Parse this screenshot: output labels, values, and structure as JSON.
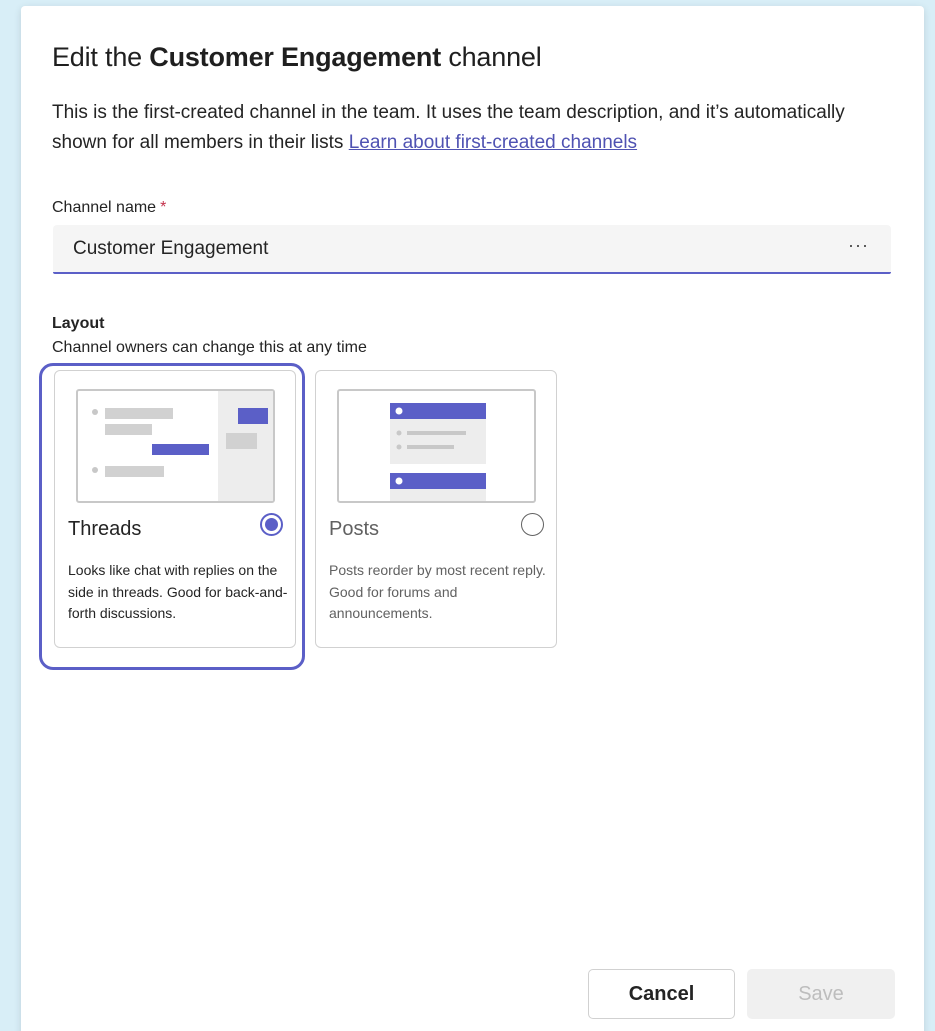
{
  "dialog": {
    "title_prefix": "Edit the ",
    "title_bold": "Customer Engagement",
    "title_suffix": " channel",
    "description": "This is the first-created channel in the team. It uses the team description, and it’s automatically shown for all members in their lists ",
    "learn_link": "Learn about first-created channels"
  },
  "channel_name": {
    "label": "Channel name",
    "required_mark": "*",
    "value": "Customer Engagement",
    "more_icon": "ellipsis-icon",
    "more_text": "···"
  },
  "layout": {
    "title": "Layout",
    "subtitle": "Channel owners can change this at any time",
    "selected": "Threads",
    "options": [
      {
        "title": "Threads",
        "description": "Looks like chat with replies on the side in threads. Good for back-and-forth discussions.",
        "checked": true
      },
      {
        "title": "Posts",
        "description": "Posts reorder by most recent reply. Good for forums and announcements.",
        "checked": false
      }
    ]
  },
  "footer": {
    "cancel_label": "Cancel",
    "save_label": "Save"
  },
  "colors": {
    "accent": "#5b5fc7",
    "link": "#4f52b2",
    "required": "#c4314b",
    "background": "#d8eef7"
  }
}
